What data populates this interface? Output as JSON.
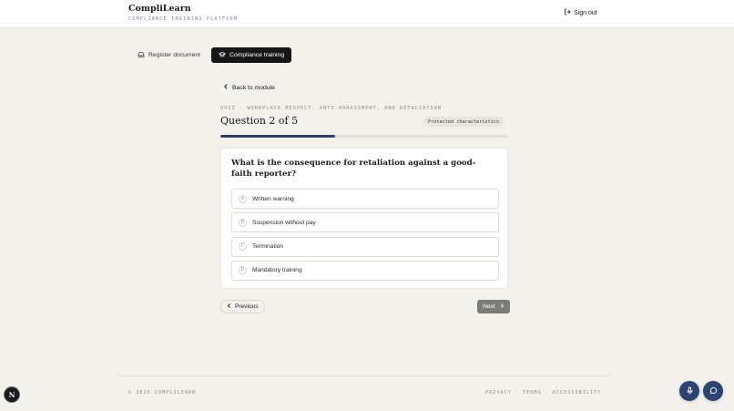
{
  "header": {
    "brand": "CompliLearn",
    "subtitle": "COMPLIANCE TRAINING PLATFORM",
    "sign_out": "Sign out"
  },
  "tabs": [
    {
      "label": "Register document",
      "icon": "inbox-icon",
      "active": false
    },
    {
      "label": "Compliance training",
      "icon": "graduation-cap-icon",
      "active": true
    }
  ],
  "back_link": "Back to module",
  "quiz": {
    "label": "QUIZ · WORKPLACE RESPECT, ANTI-HARASSMENT, AND RETALIATION",
    "title": "Question 2 of 5",
    "topic_badge": "Protected characteristics",
    "progress": 0.4,
    "question": "What is the consequence for retaliation against a good-faith reporter?",
    "options": [
      {
        "letter": "A",
        "text": "Written warning"
      },
      {
        "letter": "B",
        "text": "Suspension without pay"
      },
      {
        "letter": "C",
        "text": "Termination"
      },
      {
        "letter": "D",
        "text": "Mandatory training"
      }
    ]
  },
  "nav": {
    "previous": "Previous",
    "next": "Next"
  },
  "footer": {
    "copyright": "© 2026 COMPLILEARN",
    "links": [
      "PRIVACY",
      "TERMS",
      "ACCESSIBILITY"
    ],
    "separator": "·"
  },
  "overlay": {
    "badge_letter": "N"
  },
  "colors": {
    "accent": "#2a3f6a",
    "background": "#f3f1ec",
    "active_tab": "#161616"
  }
}
